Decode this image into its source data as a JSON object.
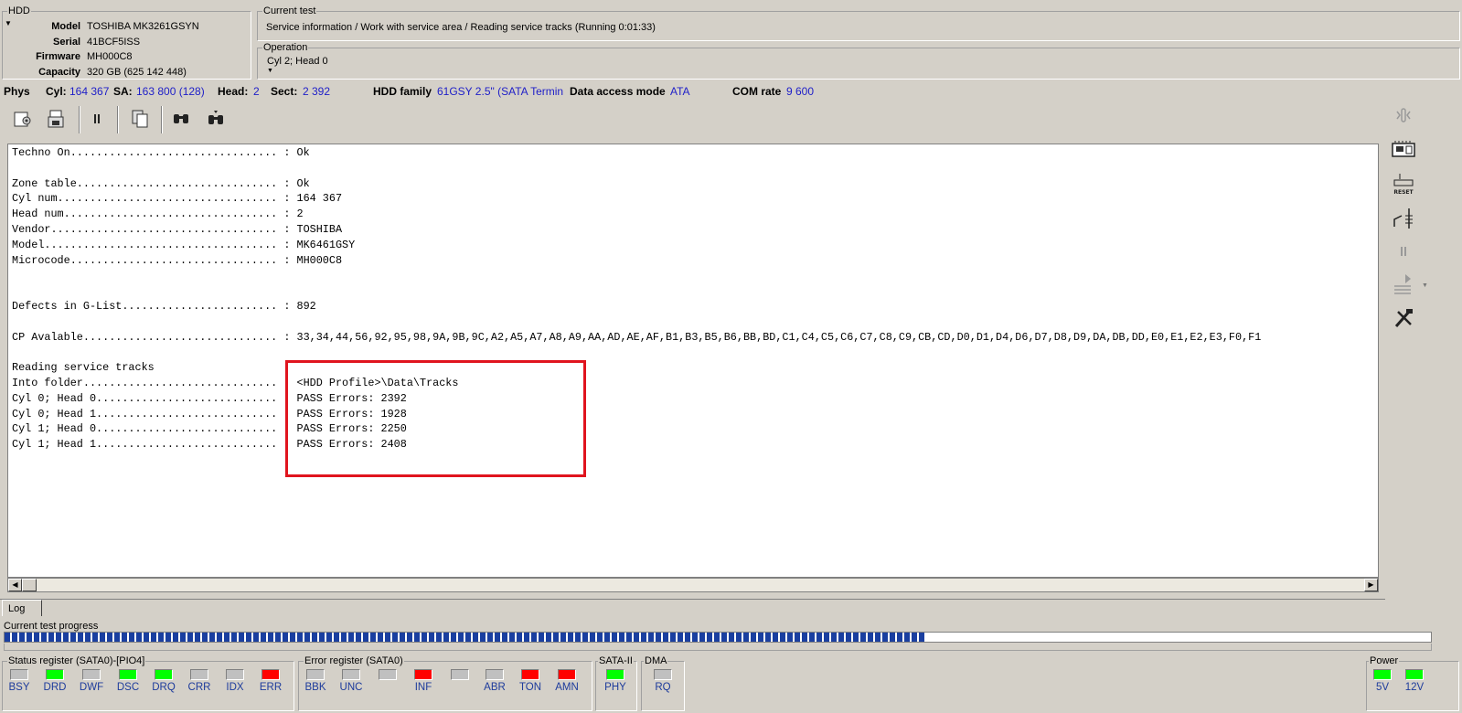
{
  "hdd": {
    "group_title": "HDD",
    "model_label": "Model",
    "model": "TOSHIBA MK3261GSYN",
    "serial_label": "Serial",
    "serial": "41BCF5ISS",
    "firmware_label": "Firmware",
    "firmware": "MH000C8",
    "capacity_label": "Capacity",
    "capacity": "320 GB (625 142 448)"
  },
  "current_test": {
    "group_title": "Current test",
    "value": "Service information / Work with service area / Reading service tracks (Running 0:01:33)"
  },
  "operation": {
    "group_title": "Operation",
    "value": "Cyl 2; Head 0"
  },
  "phys": {
    "phys_label": "Phys",
    "cyl_label": "Cyl:",
    "cyl": "164 367",
    "sa_label": "SA:",
    "sa": "163 800 (128)",
    "head_label": "Head:",
    "head": "2",
    "sect_label": "Sect:",
    "sect": "2 392",
    "family_label": "HDD family",
    "family": "61GSY 2.5\" (SATA Termin",
    "access_label": "Data access mode",
    "access": "ATA",
    "com_label": "COM rate",
    "com": "9 600"
  },
  "toolbar": {
    "icons": [
      "save-settings-icon",
      "save-to-disk-icon",
      "pause-icon",
      "copy-icon",
      "find-icon",
      "find-next-icon"
    ]
  },
  "log_lines": [
    "Techno On................................ : Ok",
    "",
    "Zone table............................... : Ok",
    "Cyl num.................................. : 164 367",
    "Head num................................. : 2",
    "Vendor................................... : TOSHIBA",
    "Model.................................... : MK6461GSY",
    "Microcode................................ : MH000C8",
    "",
    "",
    "Defects in G-List........................ : 892",
    "",
    "CP Avalable.............................. : 33,34,44,56,92,95,98,9A,9B,9C,A2,A5,A7,A8,A9,AA,AD,AE,AF,B1,B3,B5,B6,BB,BD,C1,C4,C5,C6,C7,C8,C9,CB,CD,D0,D1,D4,D6,D7,D8,D9,DA,DB,DD,E0,E1,E2,E3,F0,F1",
    "",
    "Reading service tracks",
    "Into folder.............................. : <HDD Profile>\\Data\\Tracks",
    "Cyl 0; Head 0............................ : PASS Errors: 2392",
    "Cyl 0; Head 1............................ : PASS Errors: 1928",
    "Cyl 1; Head 0............................ : PASS Errors: 2250",
    "Cyl 1; Head 1............................ : PASS Errors: 2408"
  ],
  "tabs": {
    "log": "Log"
  },
  "progress": {
    "label": "Current test progress",
    "value": 0.645
  },
  "status_register": {
    "title": "Status register (SATA0)-[PIO4]",
    "leds": [
      {
        "label": "BSY",
        "state": "gray"
      },
      {
        "label": "DRD",
        "state": "green"
      },
      {
        "label": "DWF",
        "state": "gray"
      },
      {
        "label": "DSC",
        "state": "green"
      },
      {
        "label": "DRQ",
        "state": "green"
      },
      {
        "label": "CRR",
        "state": "gray"
      },
      {
        "label": "IDX",
        "state": "gray"
      },
      {
        "label": "ERR",
        "state": "red"
      }
    ]
  },
  "error_register": {
    "title": "Error register (SATA0)",
    "leds": [
      {
        "label": "BBK",
        "state": "gray"
      },
      {
        "label": "UNC",
        "state": "gray"
      },
      {
        "label": "",
        "state": "gray"
      },
      {
        "label": "INF",
        "state": "red"
      },
      {
        "label": "",
        "state": "gray"
      },
      {
        "label": "ABR",
        "state": "gray"
      },
      {
        "label": "TON",
        "state": "red"
      },
      {
        "label": "AMN",
        "state": "red"
      }
    ]
  },
  "sata": {
    "title": "SATA-II",
    "led": {
      "label": "PHY",
      "state": "green"
    }
  },
  "dma": {
    "title": "DMA",
    "led": {
      "label": "RQ",
      "state": "gray"
    }
  },
  "power": {
    "title": "Power",
    "leds": [
      {
        "label": "5V",
        "state": "green"
      },
      {
        "label": "12V",
        "state": "green"
      }
    ]
  },
  "side_icons": [
    "power-off-icon",
    "drive-board-icon",
    "reset-icon",
    "plug-icon",
    "side-pause-icon",
    "skip-settings-icon",
    "tools-icon"
  ],
  "side_reset_text": "RESET"
}
